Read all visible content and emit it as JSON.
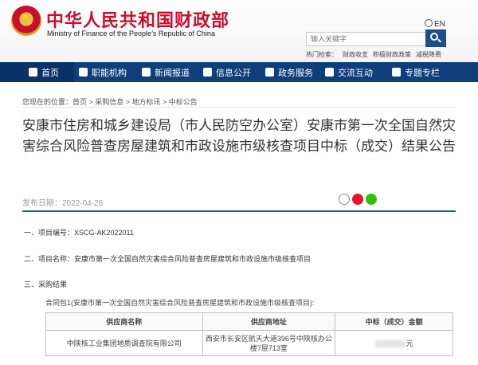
{
  "header": {
    "title_cn": "中华人民共和国财政部",
    "title_en": "Ministry of Finance of the People’s Republic of China",
    "lang_label": "EN",
    "search_placeholder": "输入关键字",
    "hot_label": "热门检索：",
    "hot_links": [
      "财政收支",
      "积极财政政策",
      "减税降费"
    ]
  },
  "nav": {
    "items": [
      {
        "label": "首页",
        "icon": "home-icon"
      },
      {
        "label": "职能机构",
        "icon": "org-icon"
      },
      {
        "label": "新闻报道",
        "icon": "news-icon"
      },
      {
        "label": "信息公开",
        "icon": "info-icon"
      },
      {
        "label": "政务服务",
        "icon": "service-icon"
      },
      {
        "label": "交流互动",
        "icon": "interaction-icon"
      },
      {
        "label": "专题专栏",
        "icon": "topic-icon"
      }
    ]
  },
  "breadcrumb": "您现在的位置：首页 > 采购信息 > 地方标讯 > 中标公告",
  "article": {
    "title": "安康市住房和城乡建设局（市人民防空办公室）安康市第一次全国自然灾害综合风险普查房屋建筑和市政设施市级核查项目中标（成交）结果公告",
    "publish_date": "发布日期：2022-04-28",
    "share_icons": [
      "share-icon",
      "weibo-icon",
      "wechat-icon"
    ],
    "sections": [
      "一、项目编号：XSCG-AK2022011",
      "二、项目名称：安康市第一次全国自然灾害综合风险普查房屋建筑和市政设施市级核查项目",
      "三、采购结果"
    ],
    "package_text": "合同包1(安康市第一次全国自然灾害综合风险普查房屋建筑和市政设施市级核查项目):",
    "table": {
      "headers": [
        "供应商名称",
        "供应商地址",
        "中标（成交）金额"
      ],
      "rows": [
        {
          "name": "中陕核工业集团地质调查院有限公司",
          "address": "西安市长安区航天大道396号中陕核办公楼7层713室",
          "amount_suffix": "元"
        }
      ]
    }
  },
  "colors": {
    "brand_red": "#c8102e",
    "nav_blue": "#0f3f7a",
    "separator_blue": "#2a5a94"
  }
}
